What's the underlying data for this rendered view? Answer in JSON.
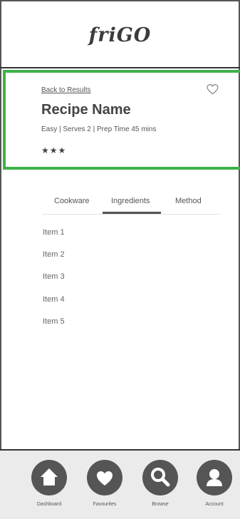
{
  "header": {
    "logo": "friGO"
  },
  "recipe": {
    "back_label": "Back to Results",
    "name": "Recipe Name",
    "meta": "Easy | Serves 2 | Prep Time 45 mins",
    "stars": "★★★",
    "rating": 3
  },
  "tabs": [
    {
      "label": "Cookware"
    },
    {
      "label": "Ingredients",
      "selected": true
    },
    {
      "label": "Method"
    }
  ],
  "items": [
    "Item 1",
    "Item 2",
    "Item 3",
    "Item 4",
    "Item 5"
  ],
  "nav": [
    {
      "label": "Dashboard",
      "icon": "home-icon"
    },
    {
      "label": "Favourites",
      "icon": "heart-icon"
    },
    {
      "label": "Browse",
      "icon": "search-icon"
    },
    {
      "label": "Account",
      "icon": "user-icon"
    }
  ],
  "colors": {
    "accent": "#3db14a",
    "dark": "#555555",
    "nav_bg": "#ebebeb"
  }
}
